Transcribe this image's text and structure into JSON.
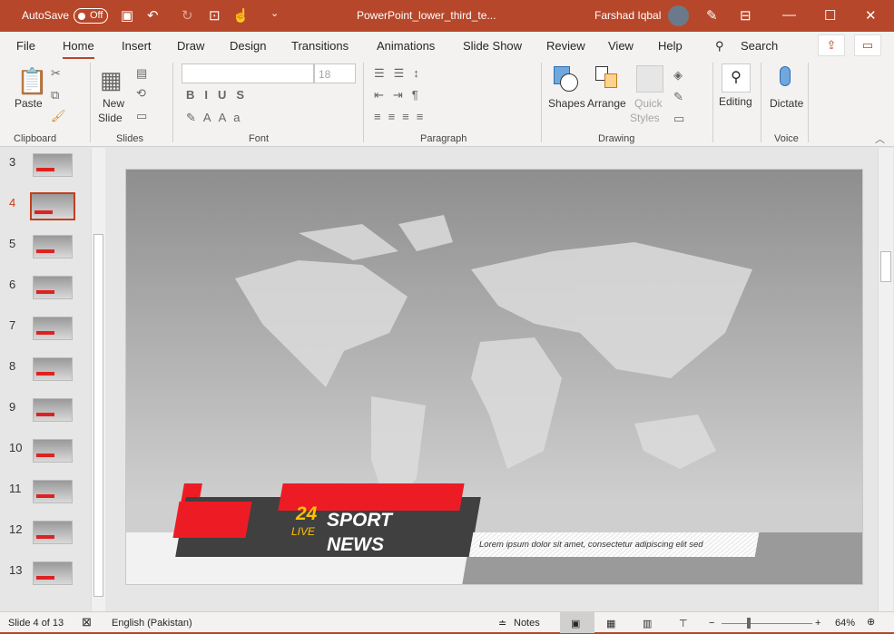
{
  "titlebar": {
    "autosave": "AutoSave",
    "autosave_state": "Off",
    "doc_title": "PowerPoint_lower_third_te...",
    "user": "Farshad Iqbal"
  },
  "tabs": [
    "File",
    "Home",
    "Insert",
    "Draw",
    "Design",
    "Transitions",
    "Animations",
    "Slide Show",
    "Review",
    "View",
    "Help"
  ],
  "search": "Search",
  "ribbon": {
    "paste": "Paste",
    "new_slide": "New",
    "new_slide2": "Slide",
    "font_size": "18",
    "shapes": "Shapes",
    "arrange": "Arrange",
    "quick": "Quick",
    "styles": "Styles",
    "editing": "Editing",
    "dictate": "Dictate",
    "groups": [
      "Clipboard",
      "Slides",
      "Font",
      "Paragraph",
      "Drawing",
      "Voice"
    ]
  },
  "thumbnails": [
    {
      "n": "3"
    },
    {
      "n": "4",
      "selected": true
    },
    {
      "n": "5"
    },
    {
      "n": "6"
    },
    {
      "n": "7"
    },
    {
      "n": "8"
    },
    {
      "n": "9"
    },
    {
      "n": "10"
    },
    {
      "n": "11"
    },
    {
      "n": "12"
    },
    {
      "n": "13"
    }
  ],
  "slide": {
    "num": "24",
    "live": "LIVE",
    "line1": "SPORT",
    "line2": "NEWS",
    "ticker": "Lorem ipsum dolor sit amet, consectetur adipiscing elit sed"
  },
  "status": {
    "slide": "Slide 4 of 13",
    "language": "English (Pakistan)",
    "notes": "Notes",
    "zoom": "64%"
  },
  "colors": {
    "accent": "#b7472a",
    "red": "#ed1c24",
    "dark": "#404040",
    "yellow": "#ffc000"
  }
}
